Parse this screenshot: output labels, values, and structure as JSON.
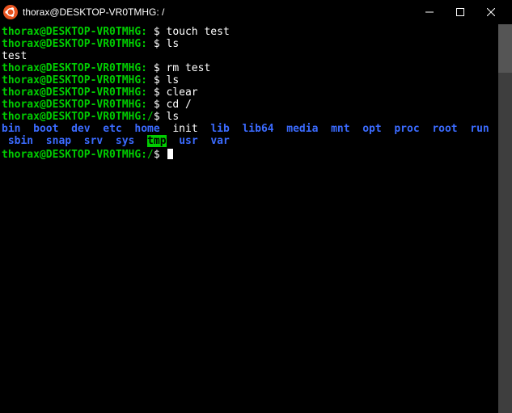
{
  "title_bar": {
    "title": "thorax@DESKTOP-VR0TMHG: /"
  },
  "prompt": {
    "user_host": "thorax@DESKTOP-VR0TMHG:",
    "path_home": " ",
    "path_root": "/",
    "dollar": "$"
  },
  "history": [
    {
      "path": "home",
      "cmd": "touch test"
    },
    {
      "path": "home",
      "cmd": "ls"
    },
    {
      "output": "test"
    },
    {
      "path": "home",
      "cmd": "rm test"
    },
    {
      "path": "home",
      "cmd": "ls"
    },
    {
      "path": "home",
      "cmd": "clear"
    },
    {
      "path": "home",
      "cmd": "cd /"
    },
    {
      "path": "root",
      "cmd": "ls"
    }
  ],
  "ls_output": [
    {
      "name": "bin",
      "type": "dir"
    },
    {
      "name": "boot",
      "type": "dir"
    },
    {
      "name": "dev",
      "type": "dir"
    },
    {
      "name": "etc",
      "type": "dir"
    },
    {
      "name": "home",
      "type": "dir"
    },
    {
      "name": "init",
      "type": "file"
    },
    {
      "name": "lib",
      "type": "dir"
    },
    {
      "name": "lib64",
      "type": "dir"
    },
    {
      "name": "media",
      "type": "dir"
    },
    {
      "name": "mnt",
      "type": "dir"
    },
    {
      "name": "opt",
      "type": "dir"
    },
    {
      "name": "proc",
      "type": "dir"
    },
    {
      "name": "root",
      "type": "dir"
    },
    {
      "name": "run",
      "type": "dir"
    },
    {
      "name": "sbin",
      "type": "dir"
    },
    {
      "name": "snap",
      "type": "dir"
    },
    {
      "name": "srv",
      "type": "dir"
    },
    {
      "name": "sys",
      "type": "dir"
    },
    {
      "name": "tmp",
      "type": "highlight"
    },
    {
      "name": "usr",
      "type": "dir"
    },
    {
      "name": "var",
      "type": "dir"
    }
  ],
  "ls_wrap_at": 14,
  "current_prompt_path": "root",
  "colors": {
    "prompt": "#00cc00",
    "dir": "#3b6bff",
    "highlight_bg": "#00cc00",
    "bg": "#000000"
  }
}
